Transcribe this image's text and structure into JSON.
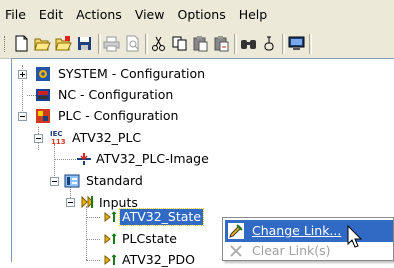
{
  "menubar": {
    "file": "File",
    "edit": "Edit",
    "actions": "Actions",
    "view": "View",
    "options": "Options",
    "help": "Help"
  },
  "toolbar": {
    "icons": [
      "new-icon",
      "open-icon",
      "open-project-icon",
      "save-icon",
      "print-icon",
      "print-preview-icon",
      "cut-icon",
      "copy-icon",
      "paste-icon",
      "paste-with-links-icon",
      "find-icon",
      "replace-icon",
      "monitor-icon"
    ]
  },
  "tree": {
    "system": "SYSTEM - Configuration",
    "nc": "NC - Configuration",
    "plc": "PLC - Configuration",
    "iec_badge": "IEC\n1131",
    "project": "ATV32_PLC",
    "image": "ATV32_PLC-Image",
    "standard": "Standard",
    "inputs": "Inputs",
    "var1": "ATV32_State",
    "var2": "PLCstate",
    "var3": "ATV32_PDO"
  },
  "context_menu": {
    "change_link": "Change Link...",
    "clear_links": "Clear Link(s)"
  },
  "colors": {
    "selection": "#316ac5",
    "chrome": "#ece9d8",
    "disabled_text": "#a0a0a0"
  }
}
